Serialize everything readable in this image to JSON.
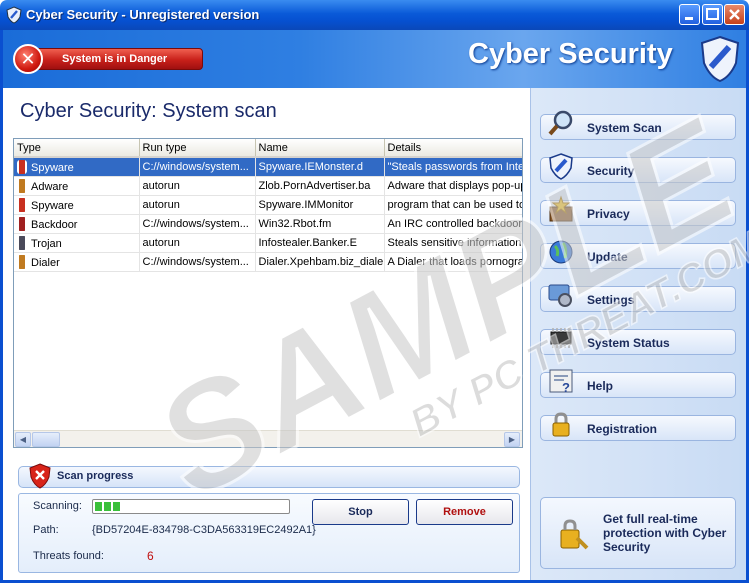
{
  "window": {
    "title": "Cyber Security - Unregistered version"
  },
  "header": {
    "danger_label": "System is in Danger",
    "brand": "Cyber Security"
  },
  "main": {
    "title": "Cyber Security: System scan"
  },
  "table": {
    "columns": [
      "Type",
      "Run type",
      "Name",
      "Details"
    ],
    "rows": [
      {
        "type": "Spyware",
        "run": "C://windows/system...",
        "name": "Spyware.IEMonster.d",
        "details": "\"Steals passwords from Internet Explorer",
        "bug": "#c83020"
      },
      {
        "type": "Adware",
        "run": "autorun",
        "name": "Zlob.PornAdvertiser.ba",
        "details": "Adware that displays pop-up advertisements",
        "bug": "#c07a20"
      },
      {
        "type": "Spyware",
        "run": "autorun",
        "name": "Spyware.IMMonitor",
        "details": "program that can be used to monitor chats",
        "bug": "#c83020"
      },
      {
        "type": "Backdoor",
        "run": "C://windows/system...",
        "name": "Win32.Rbot.fm",
        "details": "An IRC controlled backdoor that provides",
        "bug": "#a02020"
      },
      {
        "type": "Trojan",
        "run": "autorun",
        "name": "Infostealer.Banker.E",
        "details": "Steals sensitive information from the",
        "bug": "#4a4a5a"
      },
      {
        "type": "Dialer",
        "run": "C://windows/system...",
        "name": "Dialer.Xpehbam.biz_dialer",
        "details": "A Dialer that loads pornographic content",
        "bug": "#c07a20"
      }
    ]
  },
  "progress": {
    "title": "Scan progress",
    "scanning_label": "Scanning:",
    "path_label": "Path:",
    "path_value": "{BD57204E-834798-C3DA563319EC2492A1}",
    "threats_label": "Threats found:",
    "threats_value": "6",
    "percent": 0.14,
    "stop_label": "Stop",
    "remove_label": "Remove"
  },
  "sidebar": {
    "items": [
      {
        "label": "System Scan",
        "icon": "magnifier-icon"
      },
      {
        "label": "Security",
        "icon": "shield-icon"
      },
      {
        "label": "Privacy",
        "icon": "privacy-icon"
      },
      {
        "label": "Update",
        "icon": "globe-icon"
      },
      {
        "label": "Settings",
        "icon": "settings-icon"
      },
      {
        "label": "System Status",
        "icon": "chip-icon"
      },
      {
        "label": "Help",
        "icon": "help-icon"
      },
      {
        "label": "Registration",
        "icon": "lock-icon"
      }
    ],
    "promo": "Get full real-time protection with Cyber Security"
  },
  "watermark": {
    "line1": "SAMPLE",
    "line2": "BY PC THREAT.COM"
  },
  "colors": {
    "titlebar": "#0a5ad8",
    "danger": "#c8201a",
    "selected_row": "#316ac5",
    "threats": "#c01010"
  }
}
